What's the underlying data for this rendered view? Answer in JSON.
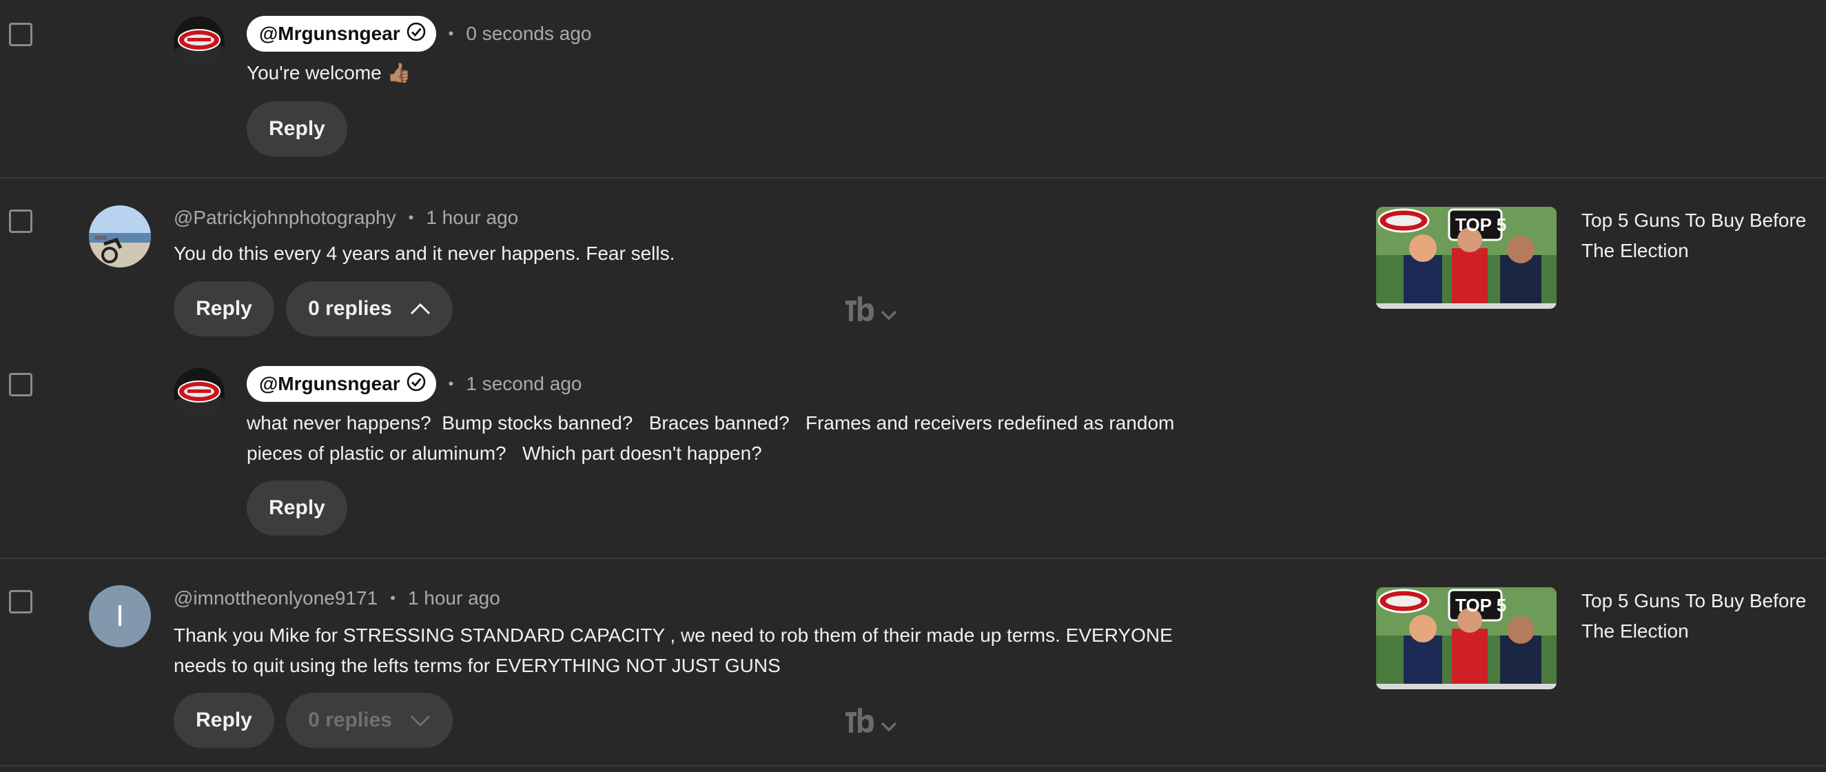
{
  "comments": [
    {
      "author": "@Mrgunsngear",
      "is_owner": true,
      "time": "0 seconds ago",
      "text": "You're welcome 👍🏽",
      "reply_label": "Reply"
    },
    {
      "author": "@Patrickjohnphotography",
      "is_owner": false,
      "time": "1 hour ago",
      "text": "You do this every 4 years and it never happens. Fear sells.",
      "reply_label": "Reply",
      "replies_label": "0 replies",
      "replies_expanded": true,
      "video_title": "Top 5 Guns To Buy Before The Election",
      "thumb_badge": "TOP 5"
    },
    {
      "author": "@Mrgunsngear",
      "is_owner": true,
      "time": "1 second ago",
      "text": "what never happens?  Bump stocks banned?   Braces banned?   Frames and receivers redefined as random pieces of plastic or aluminum?   Which part doesn't happen?",
      "reply_label": "Reply"
    },
    {
      "author": "@imnottheonlyone9171",
      "avatar_letter": "I",
      "is_owner": false,
      "time": "1 hour ago",
      "text": "Thank you Mike for STRESSING STANDARD CAPACITY , we need to rob them of their made up terms. EVERYONE  needs to quit using the lefts terms for EVERYTHING NOT JUST GUNS",
      "reply_label": "Reply",
      "replies_label": "0 replies",
      "replies_expanded": false,
      "video_title": "Top 5 Guns To Buy Before The Election",
      "thumb_badge": "TOP 5"
    }
  ],
  "icons": {
    "verified": "check-circle-icon",
    "chevron_up": "chevron-up-icon",
    "chevron_down": "chevron-down-icon",
    "tubebuddy": "tubebuddy-icon"
  },
  "colors": {
    "background": "#282828",
    "pill": "#3d3d3d",
    "owner_chip": "#ffffff",
    "secondary_text": "#aaaaaa",
    "letter_avatar": "#8298ad"
  }
}
